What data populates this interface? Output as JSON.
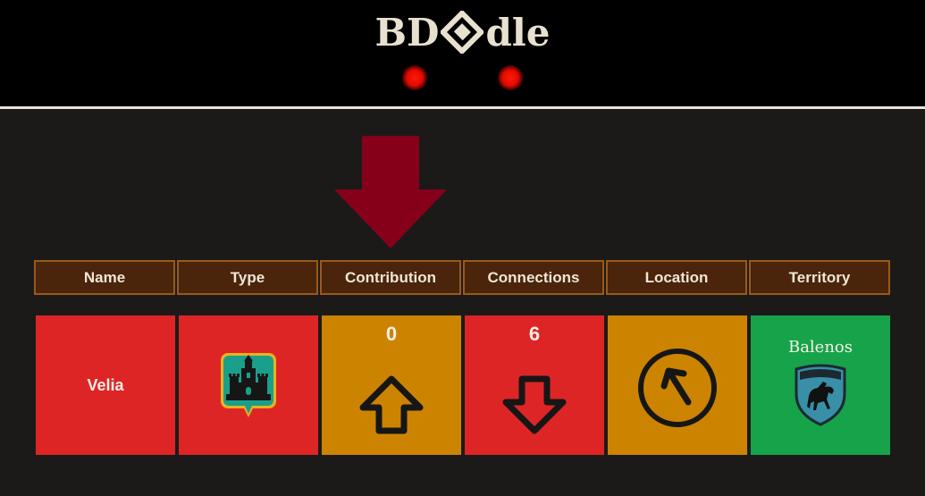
{
  "header": {
    "logo_left": "BD",
    "logo_right": "dle",
    "logo_mark_icon": "bdo-emblem-icon",
    "lives_remaining": 2
  },
  "colors": {
    "header_bg": "#000000",
    "page_bg": "#1b1a19",
    "column_header_bg": "#4a240b",
    "column_header_border": "#9a5a19",
    "wrong": "#de2526",
    "partial": "#cc8400",
    "correct": "#16a34a",
    "hint_arrow": "#86001a",
    "life_dot": "#ff1a0a"
  },
  "columns": [
    "Name",
    "Type",
    "Contribution",
    "Connections",
    "Location",
    "Territory"
  ],
  "guesses": [
    {
      "name": {
        "value": "Velia",
        "status": "wrong"
      },
      "type": {
        "icon": "castle-town-icon",
        "status": "wrong"
      },
      "contribution": {
        "value": "0",
        "hint": "higher",
        "icon": "arrow-up-icon",
        "status": "partial"
      },
      "connections": {
        "value": "6",
        "hint": "lower",
        "icon": "arrow-down-icon",
        "status": "wrong"
      },
      "location": {
        "icon": "compass-arrow-icon",
        "direction": "north-west",
        "status": "partial"
      },
      "territory": {
        "value": "Balenos",
        "icon": "balenos-crest-icon",
        "status": "correct"
      }
    }
  ],
  "hint_indicator": {
    "icon": "down-arrow-icon",
    "points_to": "Contribution"
  }
}
